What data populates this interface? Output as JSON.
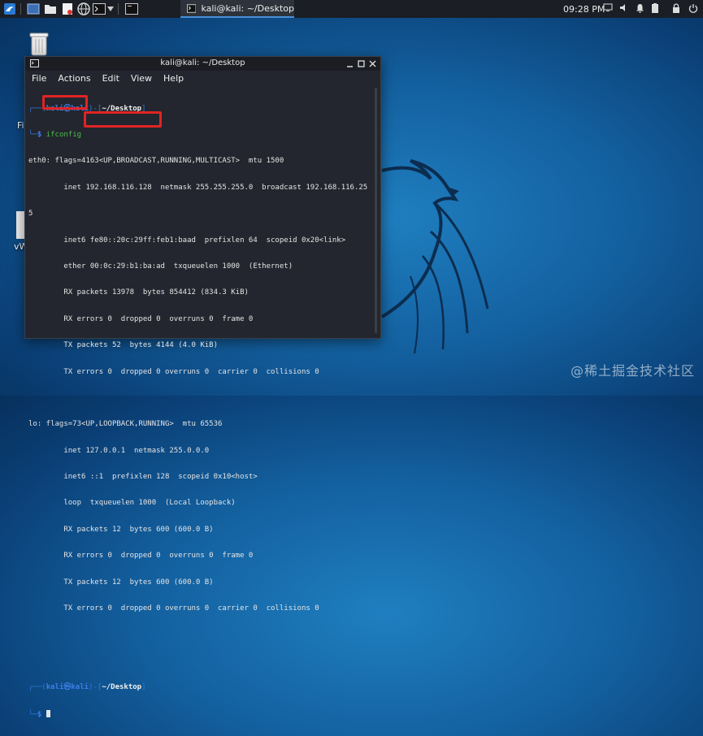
{
  "taskbar": {
    "task_title": "kali@kali: ~/Desktop",
    "clock": "09:28 PM"
  },
  "desktop": {
    "left_label_1": "Fi",
    "left_label_2": "vW"
  },
  "window": {
    "title": "kali@kali: ~/Desktop",
    "menu": [
      "File",
      "Actions",
      "Edit",
      "View",
      "Help"
    ]
  },
  "terminal": {
    "prompt1_user": "kali㉿kali",
    "prompt1_dir": "~/Desktop",
    "command": "ifconfig",
    "eth0": [
      "eth0: flags=4163<UP,BROADCAST,RUNNING,MULTICAST>  mtu 1500",
      "        inet 192.168.116.128  netmask 255.255.255.0  broadcast 192.168.116.25",
      "5",
      "        inet6 fe80::20c:29ff:feb1:baad  prefixlen 64  scopeid 0x20<link>",
      "        ether 00:0c:29:b1:ba:ad  txqueuelen 1000  (Ethernet)",
      "        RX packets 13978  bytes 854412 (834.3 KiB)",
      "        RX errors 0  dropped 0  overruns 0  frame 0",
      "        TX packets 52  bytes 4144 (4.0 KiB)",
      "        TX errors 0  dropped 0 overruns 0  carrier 0  collisions 0"
    ],
    "lo": [
      "lo: flags=73<UP,LOOPBACK,RUNNING>  mtu 65536",
      "        inet 127.0.0.1  netmask 255.0.0.0",
      "        inet6 ::1  prefixlen 128  scopeid 0x10<host>",
      "        loop  txqueuelen 1000  (Local Loopback)",
      "        RX packets 12  bytes 600 (600.0 B)",
      "        RX errors 0  dropped 0  overruns 0  frame 0",
      "        TX packets 12  bytes 600 (600.0 B)",
      "        TX errors 0  dropped 0 overruns 0  carrier 0  collisions 0"
    ],
    "prompt2_user": "kali㉿kali",
    "prompt2_dir": "~/Desktop",
    "dollar": "$"
  },
  "watermark": "@稀土掘金技术社区",
  "colors": {
    "highlight": "#e02424",
    "prompt_blue": "#2e7bd6",
    "command_green": "#4fbc4f"
  },
  "icons": {
    "taskbar": [
      "kali-menu-icon",
      "workspace-icon",
      "file-manager-icon",
      "text-editor-icon",
      "browser-icon",
      "terminal-icon"
    ],
    "tray": [
      "display-icon",
      "volume-icon",
      "notification-bell-icon",
      "battery-icon",
      "lock-icon",
      "power-icon"
    ]
  }
}
